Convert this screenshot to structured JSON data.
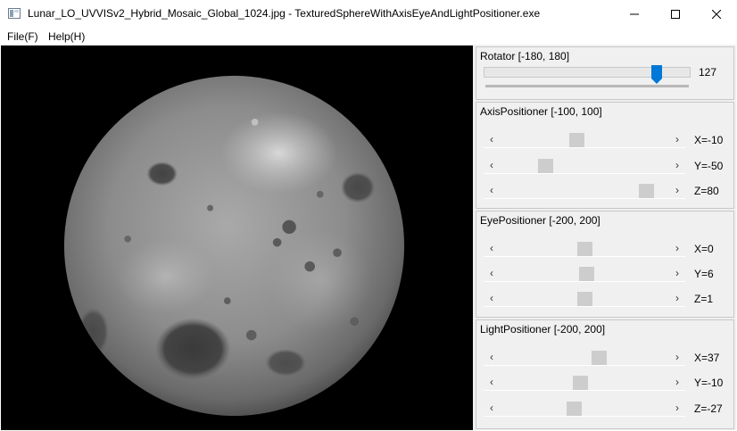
{
  "window": {
    "title": "Lunar_LO_UVVISv2_Hybrid_Mosaic_Global_1024.jpg - TexturedSphereWithAxisEyeAndLightPositioner.exe"
  },
  "menu": {
    "file": "File(F)",
    "help": "Help(H)"
  },
  "rotator": {
    "title": "Rotator [-180, 180]",
    "min": -180,
    "max": 180,
    "value": 127,
    "value_label": "127"
  },
  "axis": {
    "title": "AxisPositioner [-100, 100]",
    "min": -100,
    "max": 100,
    "sliders": [
      {
        "value": -10,
        "label": "X=-10"
      },
      {
        "value": -50,
        "label": "Y=-50"
      },
      {
        "value": 80,
        "label": "Z=80"
      }
    ]
  },
  "eye": {
    "title": "EyePositioner [-200, 200]",
    "min": -200,
    "max": 200,
    "sliders": [
      {
        "value": 0,
        "label": "X=0"
      },
      {
        "value": 6,
        "label": "Y=6"
      },
      {
        "value": 1,
        "label": "Z=1"
      }
    ]
  },
  "light": {
    "title": "LightPositioner [-200, 200]",
    "min": -200,
    "max": 200,
    "sliders": [
      {
        "value": 37,
        "label": "X=37"
      },
      {
        "value": -10,
        "label": "Y=-10"
      },
      {
        "value": -27,
        "label": "Z=-27"
      }
    ]
  },
  "icons": {
    "left_arrow": "‹",
    "right_arrow": "›"
  },
  "colors": {
    "accent": "#0078d7",
    "viewport_bg": "#000000"
  }
}
